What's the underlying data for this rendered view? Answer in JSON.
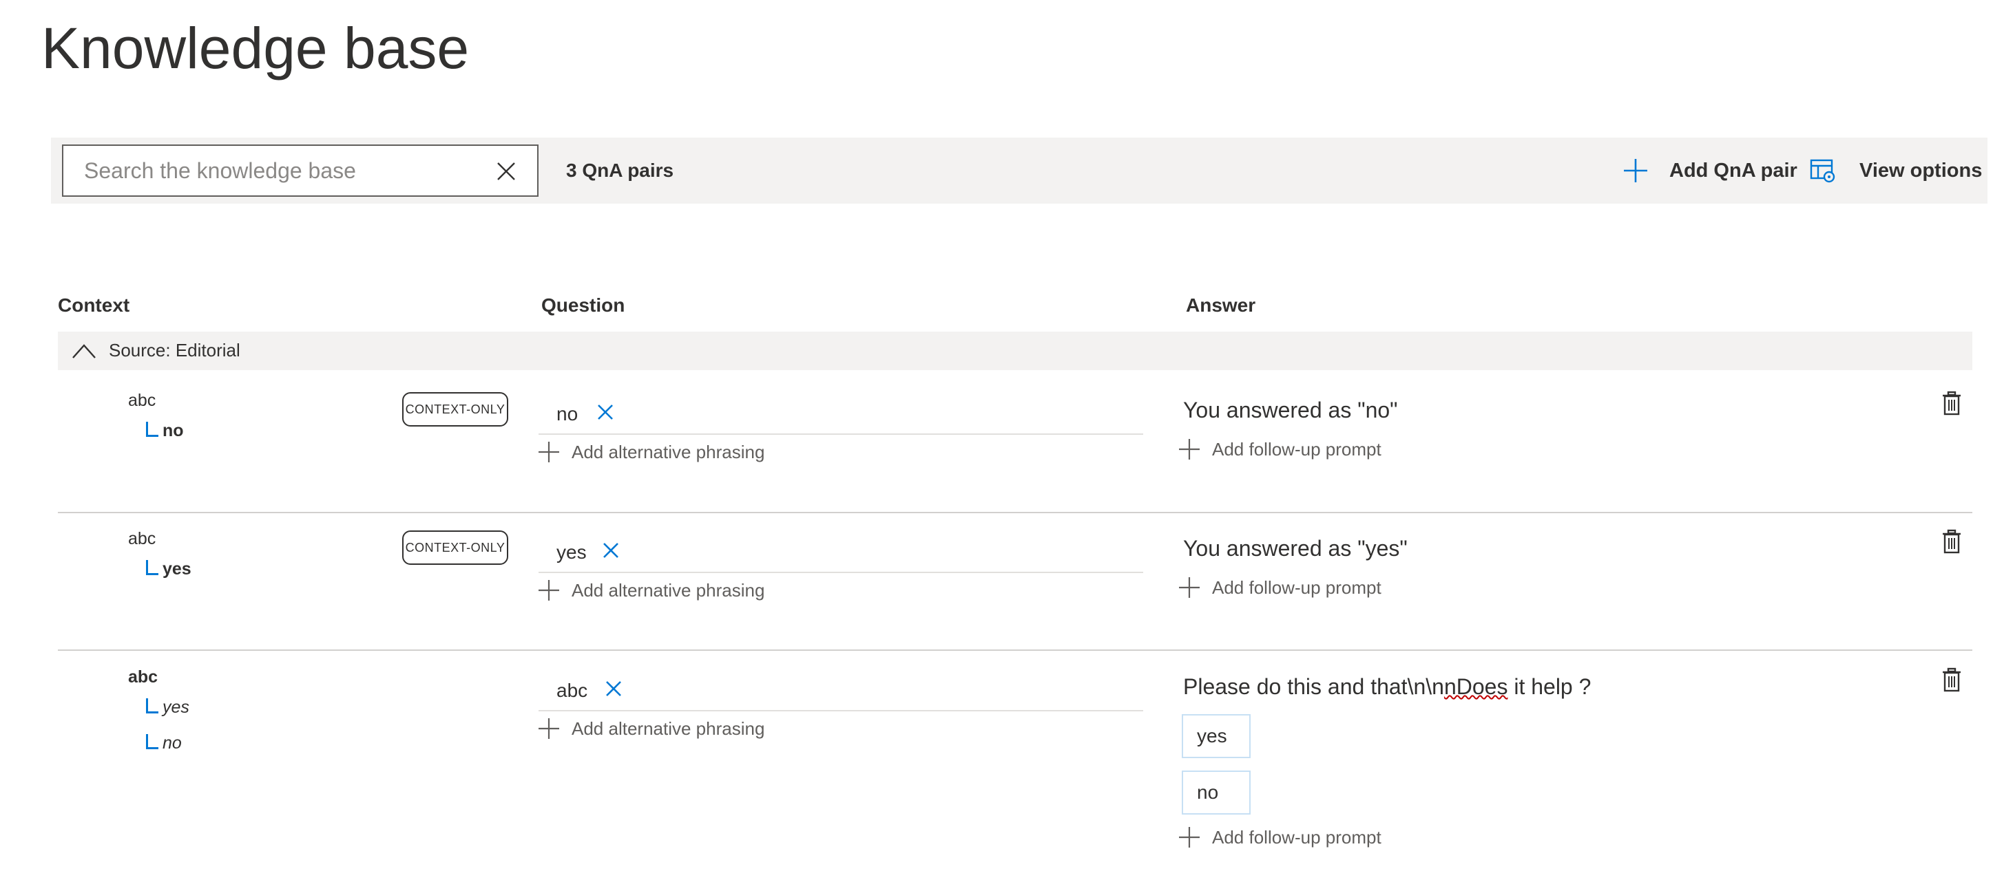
{
  "page": {
    "title": "Knowledge base"
  },
  "toolbar": {
    "search_placeholder": "Search the knowledge base",
    "search_value": "",
    "pair_count": "3 QnA pairs",
    "add_pair_label": "Add QnA pair",
    "view_options_label": "View options"
  },
  "columns": {
    "context": "Context",
    "question": "Question",
    "answer": "Answer"
  },
  "group": {
    "label": "Source: Editorial"
  },
  "rows": [
    {
      "context_parent": "abc",
      "context_children": [
        "no"
      ],
      "badge": "CONTEXT-ONLY",
      "question": "no",
      "add_alt_label": "Add alternative phrasing",
      "answer": "You answered as \"no\"",
      "prompts": [],
      "add_prompt_label": "Add follow-up prompt"
    },
    {
      "context_parent": "abc",
      "context_children": [
        "yes"
      ],
      "badge": "CONTEXT-ONLY",
      "question": "yes",
      "add_alt_label": "Add alternative phrasing",
      "answer": "You answered as \"yes\"",
      "prompts": [],
      "add_prompt_label": "Add follow-up prompt"
    },
    {
      "context_parent": "abc",
      "context_children": [
        "yes",
        "no"
      ],
      "badge": "",
      "question": "abc",
      "add_alt_label": "Add alternative phrasing",
      "answer_pre": "Please do this and that\\n\\n",
      "answer_spell": "nDoes",
      "answer_post": " it help ?",
      "prompts": [
        "yes",
        "no"
      ],
      "add_prompt_label": "Add follow-up prompt"
    }
  ],
  "colors": {
    "accent": "#0078d4",
    "toolbar_bg": "#f3f2f1",
    "text": "#323130"
  }
}
